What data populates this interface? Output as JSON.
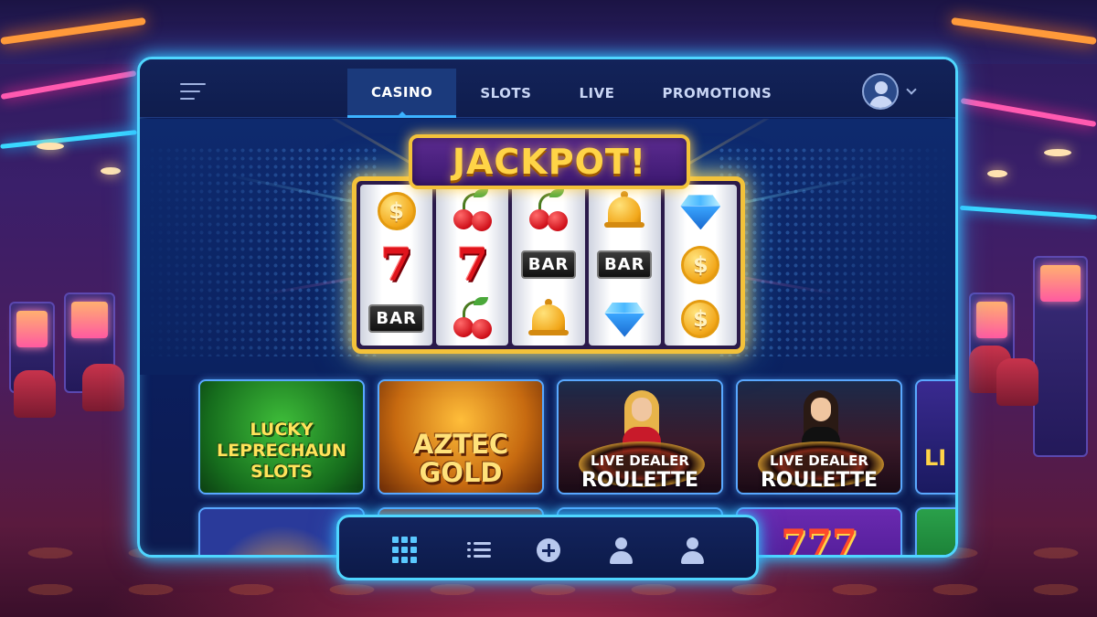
{
  "nav": {
    "tabs": [
      {
        "label": "CASINO",
        "active": true
      },
      {
        "label": "SLOTS",
        "active": false
      },
      {
        "label": "LIVE",
        "active": false
      },
      {
        "label": "PROMOTIONS",
        "active": false
      }
    ],
    "menu_icon": "hamburger-menu-icon",
    "profile_icon": "user-avatar-icon",
    "dropdown_icon": "chevron-down-icon"
  },
  "hero": {
    "banner": "JACKPOT!",
    "reels": [
      [
        "coin",
        "seven",
        "bar"
      ],
      [
        "cherry",
        "seven",
        "cherry"
      ],
      [
        "cherry",
        "bar",
        "bell"
      ],
      [
        "bell",
        "bar",
        "diamond"
      ],
      [
        "diamond",
        "coin",
        "coin"
      ]
    ],
    "bar_text": "BAR",
    "seven_text": "7",
    "coin_text": "$"
  },
  "games": [
    {
      "title": "LUCKY LEPRECHAUN SLOTS"
    },
    {
      "title": "AZTEC GOLD"
    },
    {
      "subtitle": "LIVE DEALER",
      "title": "ROULETTE"
    },
    {
      "subtitle": "LIVE DEALER",
      "title": "ROULETTE"
    },
    {
      "title": "LI"
    }
  ],
  "games_row2": [
    {
      "icon": "trophy-cup-icon"
    },
    {
      "icon": "game-thumbnail"
    },
    {
      "icon": "game-thumbnail"
    },
    {
      "title": "777"
    },
    {
      "icon": "game-thumbnail"
    }
  ],
  "dock": {
    "items": [
      {
        "icon": "grid-icon",
        "active": true
      },
      {
        "icon": "list-icon",
        "active": false
      },
      {
        "icon": "plus-circle-icon",
        "active": false
      },
      {
        "icon": "user-icon",
        "active": false
      },
      {
        "icon": "user-icon",
        "active": false
      }
    ]
  },
  "colors": {
    "accent": "#4fd6ff",
    "gold": "#f3c23a",
    "panel": "#0d1e55"
  }
}
